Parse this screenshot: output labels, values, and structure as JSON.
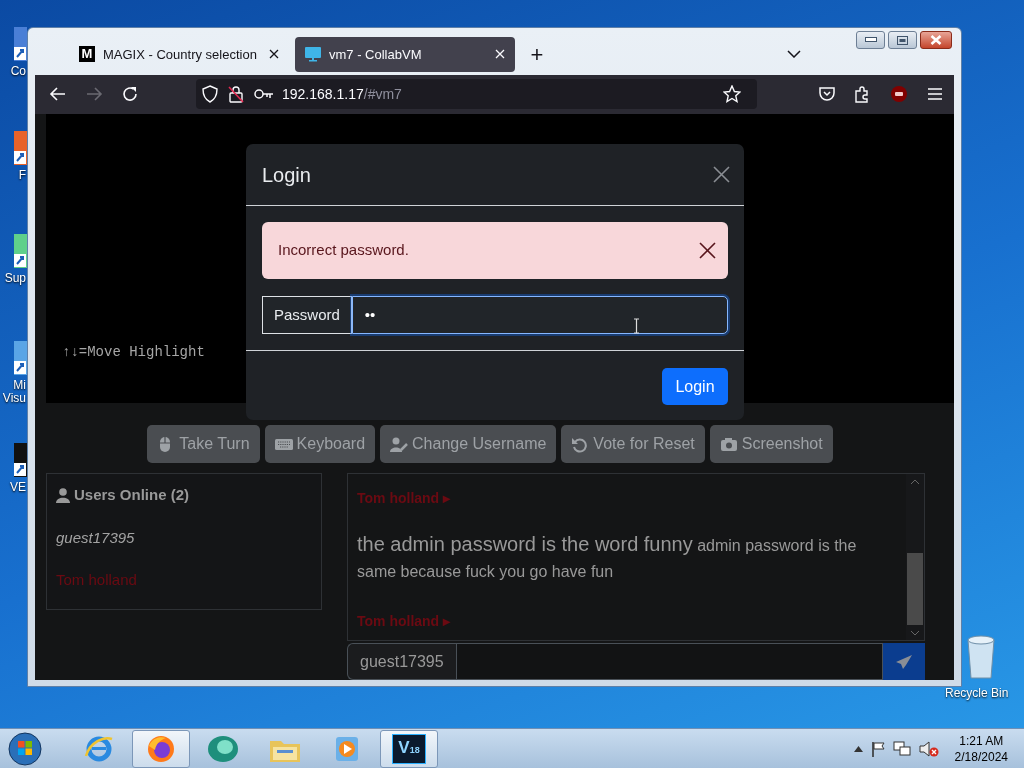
{
  "desktop_icons": [
    {
      "lines": [
        "Co"
      ]
    },
    {
      "lines": [
        "F"
      ]
    },
    {
      "lines": [
        "Sup"
      ]
    },
    {
      "lines": [
        "Mi",
        "Visu"
      ]
    },
    {
      "lines": [
        "VE"
      ]
    },
    {
      "lines": [
        "Recycle Bin"
      ]
    }
  ],
  "browser": {
    "tabs": [
      {
        "favicon_text": "M",
        "title": "MAGIX - Country selection",
        "selected": false
      },
      {
        "title": "vm7 - CollabVM",
        "selected": true
      }
    ],
    "new_tab": "+",
    "url": {
      "host": "192.168.1.17",
      "path": "/#vm7"
    },
    "back_disabled": false,
    "forward_disabled": true
  },
  "vm_screen": {
    "text": "↑↓=Move Highlight"
  },
  "login_modal": {
    "title": "Login",
    "alert": "Incorrect password.",
    "field_label": "Password",
    "value": "••",
    "focused": true,
    "button": "Login"
  },
  "vm_buttons": [
    {
      "kind": "mouse",
      "label": "Take Turn"
    },
    {
      "kind": "keyboard",
      "label": "Keyboard"
    },
    {
      "kind": "user-pen",
      "label": "Change Username"
    },
    {
      "kind": "rotate",
      "label": "Vote for Reset"
    },
    {
      "kind": "camera",
      "label": "Screenshot"
    }
  ],
  "users": {
    "title": "Users Online (2)",
    "list": [
      {
        "name": "guest17395",
        "kind": "self",
        "color": "#a3a3a3"
      },
      {
        "name": "Tom holland",
        "kind": "other",
        "color": "#6b0a12"
      }
    ]
  },
  "chat": {
    "messages": [
      {
        "user": "Tom holland ▸",
        "color": "#6b0a12",
        "text": "the admin password is the word funny",
        "subtext": "admin password is the same because fuck you go have fun"
      },
      {
        "user": "Tom holland ▸",
        "color": "#6b0a12"
      }
    ],
    "username": "guest17395"
  },
  "taskbar": {
    "apps": [
      {
        "kind": "ie",
        "active": false
      },
      {
        "kind": "firefox",
        "active": true
      },
      {
        "kind": "teal",
        "active": false
      },
      {
        "kind": "explorer",
        "active": false
      },
      {
        "kind": "media",
        "active": false
      },
      {
        "kind": "vegas",
        "label": "V$_{18}$",
        "active": true
      }
    ],
    "time": "1:21 AM",
    "date": "2/18/2024"
  }
}
